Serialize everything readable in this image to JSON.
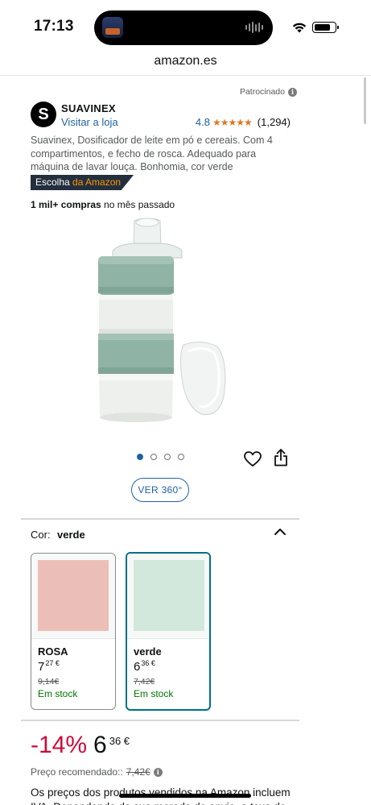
{
  "status_bar": {
    "time": "17:13",
    "icons": [
      "wifi-icon",
      "battery-icon"
    ]
  },
  "browser": {
    "address": "amazon.es"
  },
  "ad": {
    "sponsored_label": "Patrocinado",
    "brand_name": "SUAVINEX",
    "brand_logo_letter": "S",
    "visit_store": "Visitar a loja",
    "rating_value": "4.8",
    "rating_stars": 4.8,
    "stars_glyph": "★★★★★",
    "review_count": "(1,294)"
  },
  "product": {
    "title": "Suavinex, Dosificador de leite em pó e cereais. Com 4 compartimentos, e fecho de rosca. Adequado para máquina de lavar louça. Bonhomia, cor verde",
    "badge_prefix": "Escolha ",
    "badge_accent": "da Amazon",
    "bought_bold": "1 mil+ compras",
    "bought_rest": " no mês passado",
    "image_count": 4,
    "active_image": 1,
    "view360_label": "VER 360°"
  },
  "color_selector": {
    "label": "Cor:",
    "selected_value": "verde",
    "options": [
      {
        "name": "ROSA",
        "price_int": "7",
        "price_dec": "27 €",
        "old_price": "9,14€",
        "stock": "Em stock",
        "swatch_color": "#ebbfb7"
      },
      {
        "name": "verde",
        "price_int": "6",
        "price_dec": "36 €",
        "old_price": "7,42€",
        "stock": "Em stock",
        "swatch_color": "#d2e8dc"
      }
    ]
  },
  "pricing": {
    "discount": "-14%",
    "price_int": "6",
    "price_dec": "36 €",
    "recommended_label": "Preço recomendado::",
    "recommended_price": "7,42€",
    "vat_note": "Os preços dos produtos vendidos na Amazon incluem IVA. Dependendo da sua morada de envio, a taxa de"
  },
  "colors": {
    "link": "#2162a1",
    "discount": "#cc0c39",
    "stock": "#007600",
    "selected_border": "#007185",
    "star": "#de7921",
    "badge_bg": "#232f3e",
    "badge_accent": "#ff9900"
  }
}
